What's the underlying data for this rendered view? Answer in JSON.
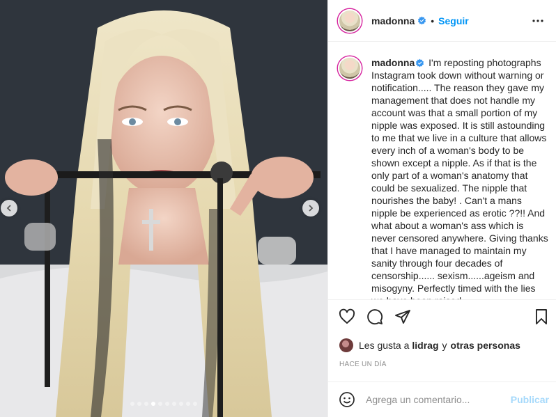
{
  "post": {
    "media": {
      "description_icon": "photo",
      "carousel_dot_count": 10,
      "carousel_active_index": 3
    },
    "header": {
      "username": "madonna",
      "separator": "•",
      "follow_label": "Seguir",
      "more_icon": "more-horizontal-icon"
    },
    "caption": {
      "username": "madonna",
      "text": "I'm reposting photographs Instagram took down without warning or notification..... The reason they gave my management that does not handle my account was that a small portion of my nipple was exposed. It is still astounding to me that we live in a culture that allows every inch of a woman's body to be shown except a nipple. As if that is the only part of a woman's anatomy that could be sexualized. The nipple that nourishes the baby! . Can't a mans nipple be experienced as erotic ??!! And what about a woman's ass which is never censored anywhere. Giving thanks that I have managed to maintain my sanity through four decades of censorship...... sexism......ageism and misogyny. Perfectly timed with the lies we have been raised"
    },
    "likes": {
      "prefix": "Les gusta a",
      "user": "lidrag",
      "connector": "y",
      "others": "otras personas"
    },
    "timestamp": "Hace un día",
    "comment_box": {
      "placeholder": "Agrega un comentario...",
      "publish_label": "Publicar"
    },
    "colors": {
      "accent": "#0095f6",
      "text": "#262626",
      "muted": "#8e8e8e",
      "border": "#efefef"
    }
  }
}
